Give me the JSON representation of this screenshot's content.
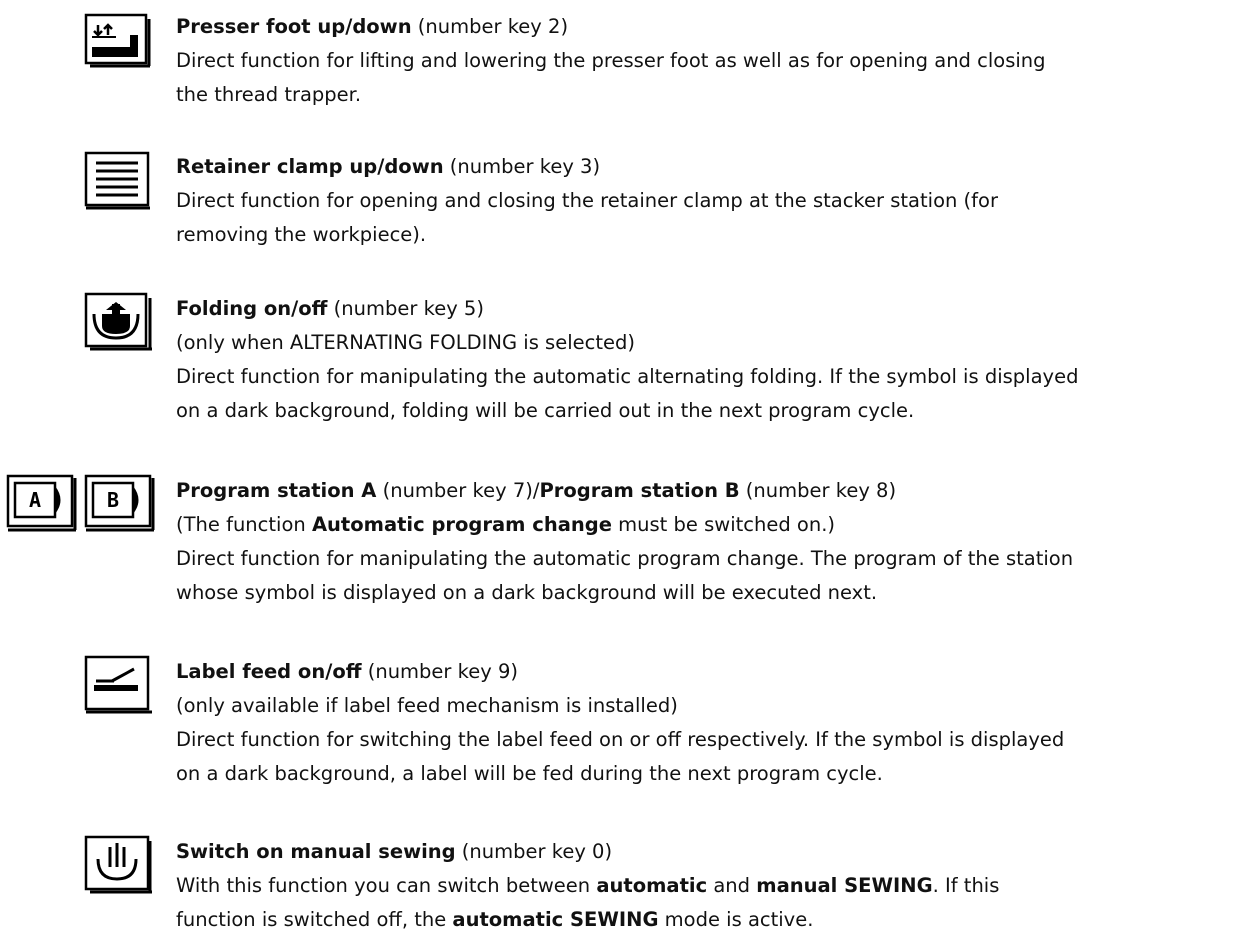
{
  "entries": [
    {
      "id": "presser-foot",
      "icon": "presser-foot-icon",
      "lines": [
        {
          "title": "Presser foot up/down",
          "rest": " (number key 2)"
        },
        {
          "text": "Direct function for lifting and lowering the presser foot as well as for opening and closing"
        },
        {
          "text": "the thread trapper."
        }
      ]
    },
    {
      "id": "retainer-clamp",
      "icon": "retainer-clamp-icon",
      "lines": [
        {
          "title": "Retainer clamp up/down",
          "rest": " (number key 3)"
        },
        {
          "text": "Direct function for opening and closing the retainer clamp at the stacker station (for"
        },
        {
          "text": "removing the workpiece)."
        }
      ]
    },
    {
      "id": "folding",
      "icon": "folding-icon",
      "lines": [
        {
          "title": "Folding on/off",
          "rest": " (number key 5)"
        },
        {
          "text": "(only when ALTERNATING FOLDING is selected)"
        },
        {
          "text": "Direct function for manipulating the automatic alternating folding. If the symbol is displayed"
        },
        {
          "text": "on a dark background, folding will be carried out in the next program cycle."
        }
      ]
    },
    {
      "id": "program-station",
      "icon_a": "program-station-a-icon",
      "icon_b": "program-station-b-icon",
      "icon_a_letter": "A",
      "icon_b_letter": "B",
      "line1": {
        "title_a": "Program station A",
        "mid": " (number key 7)/",
        "title_b": "Program station B",
        "rest": " (number key 8)"
      },
      "line2": {
        "pre": "(The function ",
        "bold": "Automatic program change",
        "post": " must be switched on.)"
      },
      "line3": "Direct function for manipulating the automatic program change. The program of the station",
      "line4": "whose symbol is displayed on a dark background will be executed next."
    },
    {
      "id": "label-feed",
      "icon": "label-feed-icon",
      "lines": [
        {
          "title": "Label feed on/off",
          "rest": " (number key 9)"
        },
        {
          "text": "(only available if label feed mechanism is installed)"
        },
        {
          "text": "Direct function for switching the label feed on or off respectively. If the symbol is displayed"
        },
        {
          "text": "on a dark background, a label will be fed during the next program cycle."
        }
      ]
    },
    {
      "id": "manual-sewing",
      "icon": "manual-sewing-hand-icon",
      "line1": {
        "title": "Switch on manual sewing",
        "rest": " (number key 0)"
      },
      "line2": {
        "pre": "With this function you can switch between ",
        "bold1": "automatic",
        "mid": " and ",
        "bold2": "manual SEWING",
        "post": ". If this"
      },
      "line3": {
        "pre": "function is switched off, the ",
        "bold": "automatic SEWING",
        "post": " mode is active."
      }
    }
  ]
}
